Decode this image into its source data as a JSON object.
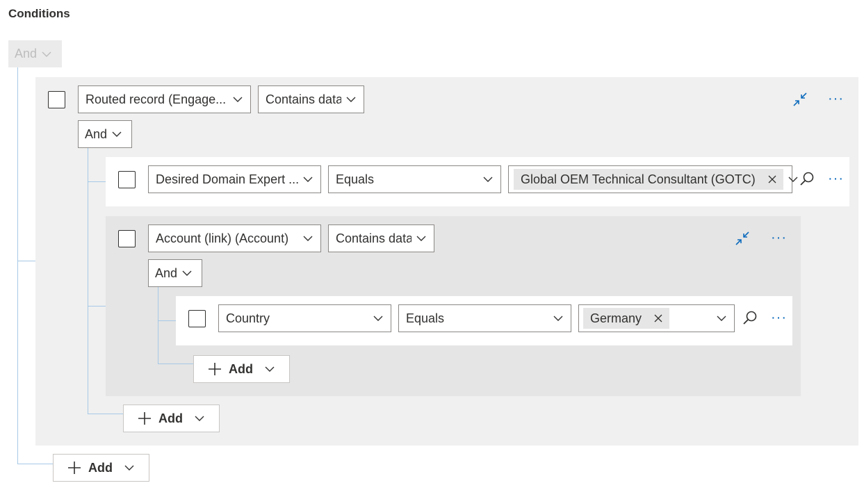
{
  "section_title": "Conditions",
  "root": {
    "operator": "And",
    "add_label": "Add"
  },
  "group1": {
    "field": "Routed record (Engage...",
    "operator": "Contains data",
    "logic": "And",
    "add_label": "Add",
    "row1": {
      "field": "Desired Domain Expert ...",
      "operator": "Equals",
      "value": "Global OEM Technical Consultant (GOTC)"
    },
    "group2": {
      "field": "Account (link) (Account)",
      "operator": "Contains data",
      "logic": "And",
      "add_label": "Add",
      "row2": {
        "field": "Country",
        "operator": "Equals",
        "value": "Germany"
      }
    }
  },
  "more_glyph": "···",
  "colors": {
    "accent": "#0f6cbd",
    "tree_line": "#a6c8e6",
    "group_bg": "#f0f0f0",
    "nested_group_bg": "#e5e5e5"
  },
  "icons": [
    "chevron-down-icon",
    "collapse-icon",
    "more-icon",
    "search-icon",
    "clear-icon",
    "plus-icon"
  ]
}
